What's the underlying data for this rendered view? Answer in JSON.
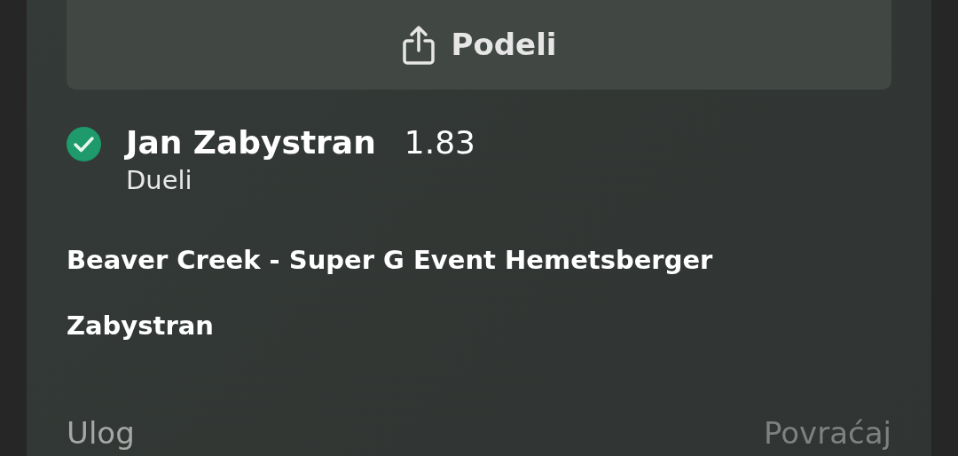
{
  "share_button": {
    "label": "Podeli"
  },
  "selection": {
    "won": true,
    "name": "Jan Zabystran",
    "odds": "1.83",
    "market": "Dueli"
  },
  "event_lines": [
    "Beaver Creek - Super G Event Hemetsberger",
    "Zabystran"
  ],
  "summary": {
    "stake_label": "Ulog",
    "return_label": "Povraćaj"
  }
}
